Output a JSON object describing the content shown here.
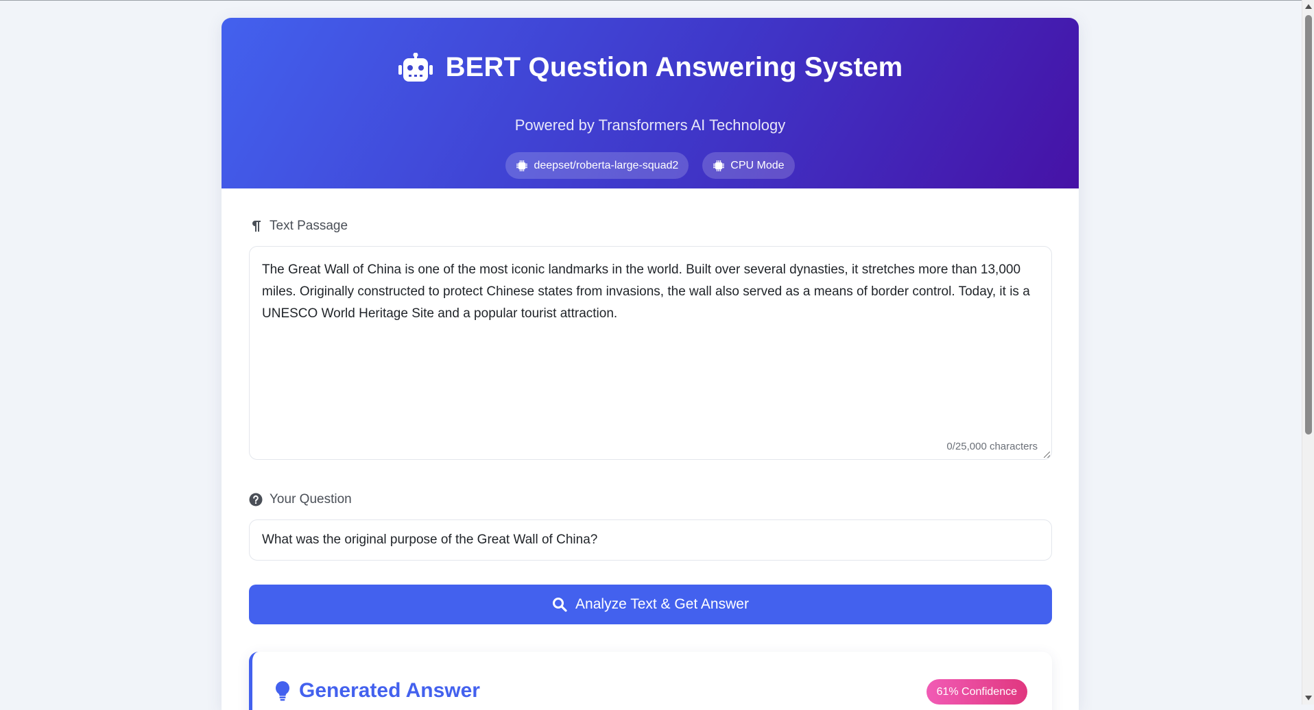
{
  "header": {
    "title": "BERT Question Answering System",
    "subtitle": "Powered by Transformers AI Technology",
    "badges": [
      {
        "label": "deepset/roberta-large-squad2",
        "icon": "chip-icon"
      },
      {
        "label": "CPU Mode",
        "icon": "chip-icon"
      }
    ]
  },
  "passage": {
    "label": "Text Passage",
    "icon": "paragraph-icon",
    "value": "The Great Wall of China is one of the most iconic landmarks in the world. Built over several dynasties, it stretches more than 13,000 miles. Originally constructed to protect Chinese states from invasions, the wall also served as a means of border control. Today, it is a UNESCO World Heritage Site and a popular tourist attraction.",
    "char_count": "0/25,000 characters"
  },
  "question": {
    "label": "Your Question",
    "icon": "question-circle-icon",
    "value": "What was the original purpose of the Great Wall of China?"
  },
  "action": {
    "label": "Analyze Text & Get Answer",
    "icon": "search-icon"
  },
  "answer": {
    "title": "Generated Answer",
    "icon": "lightbulb-icon",
    "confidence": "61% Confidence"
  },
  "colors": {
    "accent": "#4361ee",
    "hero_start": "#4361ee",
    "hero_end": "#4612a6",
    "confidence_pink": "#f15bb5",
    "page_bg": "#f1f4f9"
  }
}
